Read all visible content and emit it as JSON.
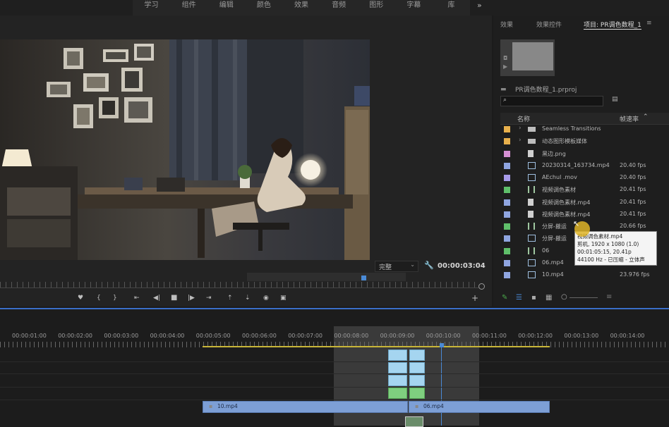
{
  "workspaces": [
    "学习",
    "组件",
    "编辑",
    "颜色",
    "效果",
    "音频",
    "图形",
    "字幕",
    "库"
  ],
  "workspace_more": "»",
  "program": {
    "fit_select": "完整",
    "timecode": "00:00:03:04"
  },
  "right_panel": {
    "tabs": [
      "效果",
      "效果控件",
      "项目: PR调色数程_1"
    ],
    "menu_icon": "≡",
    "project_file": "PR调色数程_1.prproj",
    "search_placeholder": "",
    "col_name": "名称",
    "col_fps": "帧速率",
    "items": [
      {
        "color": "#e8b04c",
        "name": "Seamless Transitions",
        "fps": "",
        "kind": "folder",
        "arrow": "›"
      },
      {
        "color": "#e8b04c",
        "name": "动态图形模板媒体",
        "fps": "",
        "kind": "folder",
        "arrow": "›"
      },
      {
        "color": "#d58fd3",
        "name": "黑边.png",
        "fps": "",
        "kind": "image",
        "arrow": ""
      },
      {
        "color": "#8fa5e0",
        "name": "20230314_163734.mp4",
        "fps": "20.40 fps",
        "kind": "video",
        "arrow": ""
      },
      {
        "color": "#a79bea",
        "name": "AEchul .mov",
        "fps": "20.40 fps",
        "kind": "video",
        "arrow": ""
      },
      {
        "color": "#5fbf6a",
        "name": "视频调色素材",
        "fps": "20.41 fps",
        "kind": "sequence",
        "arrow": ""
      },
      {
        "color": "#8fa5e0",
        "name": "视频调色素材.mp4",
        "fps": "20.41 fps",
        "kind": "file",
        "arrow": ""
      },
      {
        "color": "#8fa5e0",
        "name": "视频调色素材.mp4",
        "fps": "20.41 fps",
        "kind": "file",
        "arrow": ""
      },
      {
        "color": "#5fbf6a",
        "name": "分屏-搬运",
        "fps": "20.66 fps",
        "kind": "sequence",
        "arrow": ""
      },
      {
        "color": "#8fa5e0",
        "name": "分屏-搬运",
        "fps": "",
        "kind": "video",
        "arrow": ""
      },
      {
        "color": "#5fbf6a",
        "name": "06",
        "fps": "",
        "kind": "sequence",
        "arrow": ""
      },
      {
        "color": "#8fa5e0",
        "name": "06.mp4",
        "fps": "",
        "kind": "video",
        "arrow": ""
      },
      {
        "color": "#8fa5e0",
        "name": "10.mp4",
        "fps": "23.976 fps",
        "kind": "video",
        "arrow": ""
      }
    ],
    "tooltip": [
      "视频调色素材.mp4",
      "剪机, 1920 x 1080 (1.0)",
      "00:01:05:15, 20.41p",
      "44100 Hz - 已压缩 - 立体声"
    ]
  },
  "timeline": {
    "ticks": [
      "00:00:01:00",
      "00:00:02:00",
      "00:00:03:00",
      "00:00:04:00",
      "00:00:05:00",
      "00:00:06:00",
      "00:00:07:00",
      "00:00:08:00",
      "00:00:09:00",
      "00:00:10:00",
      "00:00:11:00",
      "00:00:12:00",
      "00:00:13:00",
      "00:00:14:00"
    ],
    "clips": [
      "10.mp4",
      "06.mp4"
    ]
  }
}
